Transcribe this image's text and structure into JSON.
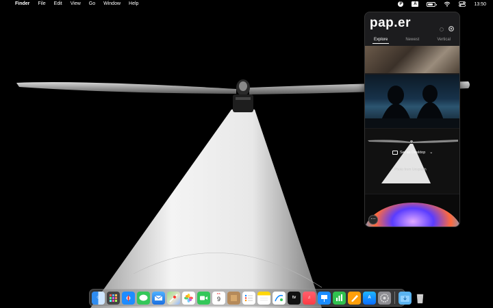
{
  "menubar": {
    "apple_glyph": "",
    "app_name": "Finder",
    "menus": [
      "File",
      "Edit",
      "View",
      "Go",
      "Window",
      "Help"
    ],
    "input_source": "A",
    "clock": "13:50"
  },
  "popover": {
    "logo": "pap.er",
    "tabs": [
      "Explore",
      "Newest",
      "Vertical"
    ],
    "active_tab": "Explore",
    "set_desktop_label": "Set as Desktop",
    "credit": "Photo  from Unsplash"
  },
  "dock": {
    "apps": [
      "Finder",
      "Launchpad",
      "Safari",
      "Messages",
      "Mail",
      "Maps",
      "Photos",
      "FaceTime",
      "Calendar",
      "Notes Stickies",
      "Reminders",
      "Notes",
      "Freeform",
      "TV",
      "Music",
      "Keynote",
      "Numbers",
      "Pages",
      "App Store",
      "System Settings",
      "Downloads",
      "Trash"
    ],
    "calendar_month": "JUL",
    "calendar_day": "9"
  },
  "colors": {
    "popover_bg": "#1c1c1e",
    "accent": "#0a84ff"
  }
}
